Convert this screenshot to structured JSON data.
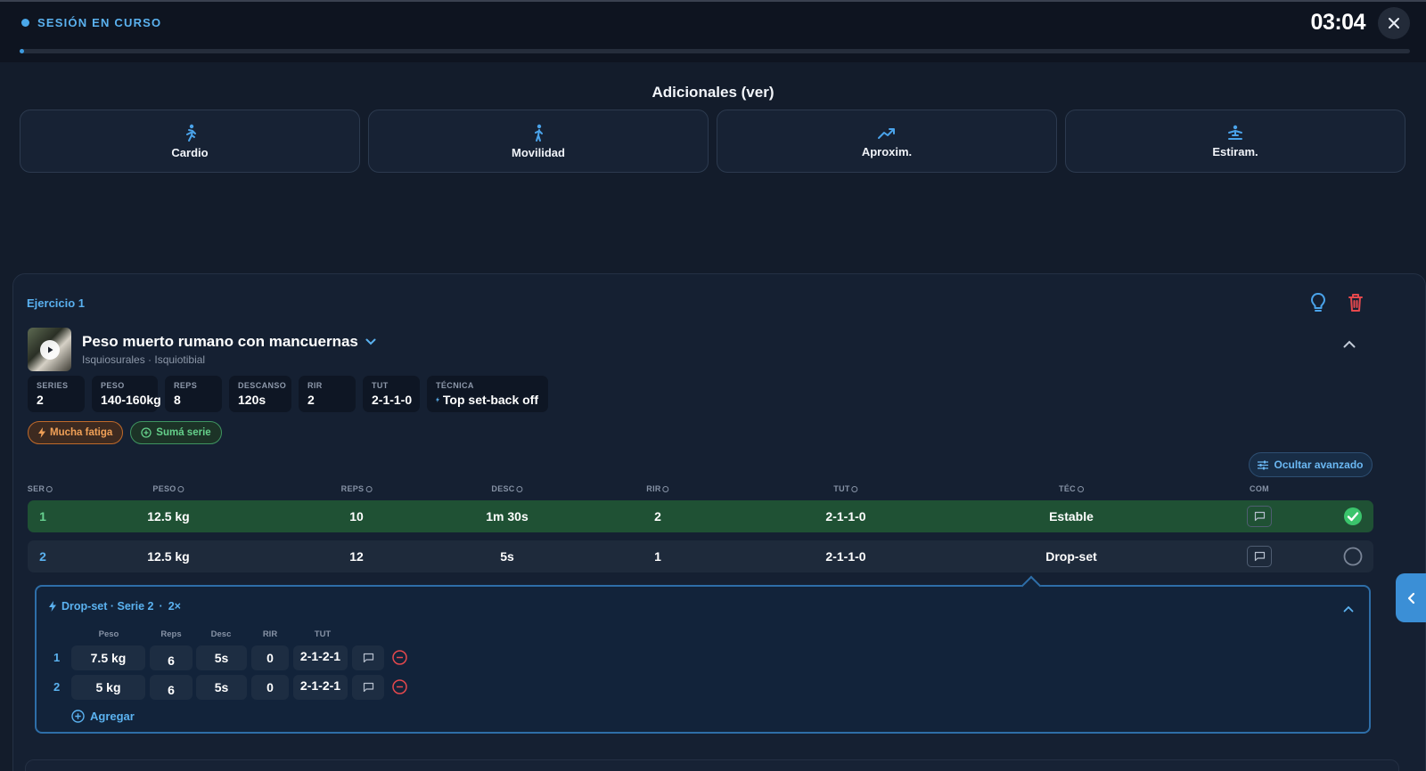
{
  "header": {
    "session_label": "SESIÓN EN CURSO",
    "timer": "03:04",
    "progress_fraction": 0.003
  },
  "additionals": {
    "title": "Adicionales (ver)",
    "cards": [
      {
        "label": "Cardio",
        "icon": "running-icon"
      },
      {
        "label": "Movilidad",
        "icon": "walking-icon"
      },
      {
        "label": "Aproxim.",
        "icon": "trending-up-icon"
      },
      {
        "label": "Estiram.",
        "icon": "stretching-icon"
      }
    ]
  },
  "exercise": {
    "number_label": "Ejercicio 1",
    "name": "Peso muerto rumano con mancuernas",
    "muscles": "Isquiosurales · Isquiotibial",
    "stats": [
      {
        "label": "SERIES",
        "value": "2"
      },
      {
        "label": "PESO",
        "value": "140-160kg"
      },
      {
        "label": "REPS",
        "value": "8"
      },
      {
        "label": "DESCANSO",
        "value": "120s"
      },
      {
        "label": "RIR",
        "value": "2"
      },
      {
        "label": "TUT",
        "value": "2-1-1-0"
      },
      {
        "label": "TÉCNICA",
        "value": "Top set-back off"
      }
    ],
    "chips": {
      "fatigue": "Mucha fatiga",
      "add_set": "Sumá serie"
    },
    "advanced_button": "Ocultar avanzado",
    "columns": [
      "SER",
      "PESO",
      "REPS",
      "DESC",
      "RIR",
      "TUT",
      "TÉC",
      "COM"
    ],
    "sets": [
      {
        "ser": "1",
        "peso": "12.5 kg",
        "reps": "10",
        "desc": "1m 30s",
        "rir": "2",
        "tut": "2-1-1-0",
        "tec": "Estable",
        "done": true
      },
      {
        "ser": "2",
        "peso": "12.5 kg",
        "reps": "12",
        "desc": "5s",
        "rir": "1",
        "tut": "2-1-1-0",
        "tec": "Drop-set",
        "done": false
      }
    ],
    "dropset": {
      "title": "Drop-set · Serie 2",
      "multiplier": "2×",
      "columns": [
        "Peso",
        "Reps",
        "Desc",
        "RIR",
        "TUT"
      ],
      "rows": [
        {
          "idx": "1",
          "peso": "7.5 kg",
          "reps": "6",
          "desc": "5s",
          "rir": "0",
          "tut": "2-1-2-1"
        },
        {
          "idx": "2",
          "peso": "5 kg",
          "reps": "6",
          "desc": "5s",
          "rir": "0",
          "tut": "2-1-2-1"
        }
      ],
      "add_label": "Agregar"
    }
  },
  "colors": {
    "accent": "#5bb2f0",
    "success": "#3bc46c",
    "danger": "#e5484d",
    "warning": "#f0a057"
  }
}
